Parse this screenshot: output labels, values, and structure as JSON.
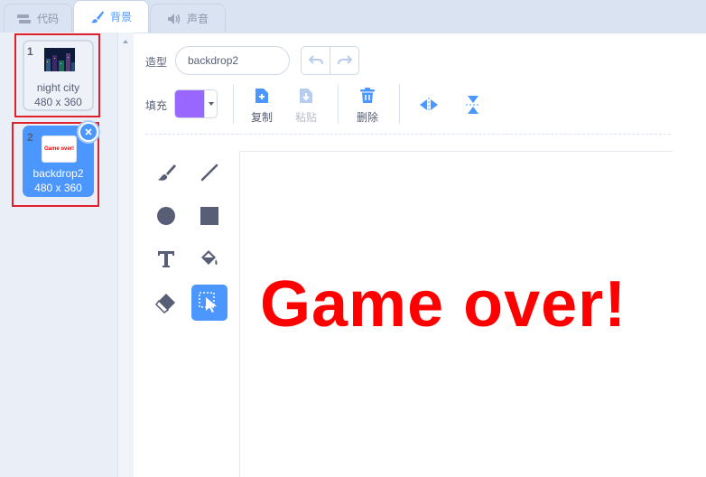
{
  "tabs": [
    {
      "label": "代码",
      "icon": "code-icon"
    },
    {
      "label": "背景",
      "icon": "brush-icon"
    },
    {
      "label": "声音",
      "icon": "speaker-icon"
    }
  ],
  "costumes": [
    {
      "number": "1",
      "name": "night city",
      "size": "480 x 360",
      "selected": false
    },
    {
      "number": "2",
      "name": "backdrop2",
      "size": "480 x 360",
      "selected": true,
      "thumb_text": "Game over!"
    }
  ],
  "editor": {
    "costume_label": "造型",
    "costume_name": "backdrop2",
    "fill_label": "填充",
    "fill_color": "#9966ff",
    "copy_label": "复制",
    "paste_label": "粘贴",
    "delete_label": "删除"
  },
  "canvas": {
    "text": "Game over!",
    "text_color": "#ff0000"
  },
  "colors": {
    "accent": "#4c97ff",
    "highlight_box": "#e0202a"
  }
}
